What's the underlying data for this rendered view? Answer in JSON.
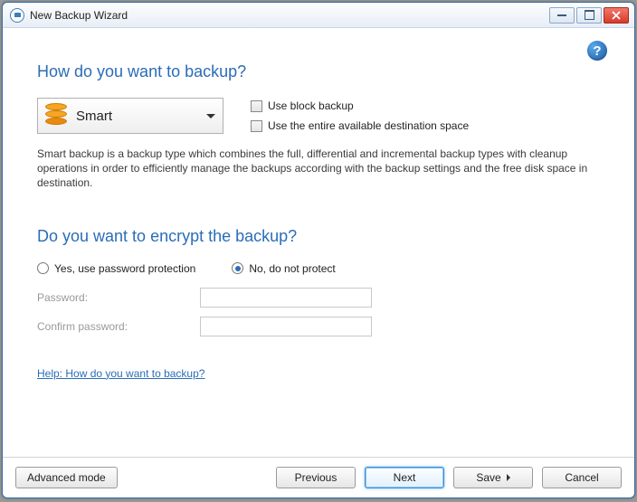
{
  "window": {
    "title": "New Backup Wizard"
  },
  "help_icon": "?",
  "section1": {
    "heading": "How do you want to backup?",
    "type_selected": "Smart",
    "checkbox1": "Use block backup",
    "checkbox2": "Use the entire available destination space",
    "description": "Smart backup is a backup type which combines the full, differential and incremental backup types with cleanup operations in order to efficiently manage the backups according with the backup settings and the free disk space in destination."
  },
  "section2": {
    "heading": "Do you want to encrypt the backup?",
    "radio_yes": "Yes, use password protection",
    "radio_no": "No, do not protect",
    "password_label": "Password:",
    "confirm_label": "Confirm password:",
    "password_value": "",
    "confirm_value": ""
  },
  "help_link": "Help: How do you want to backup?",
  "footer": {
    "advanced": "Advanced mode",
    "previous": "Previous",
    "next": "Next",
    "save": "Save",
    "cancel": "Cancel"
  }
}
